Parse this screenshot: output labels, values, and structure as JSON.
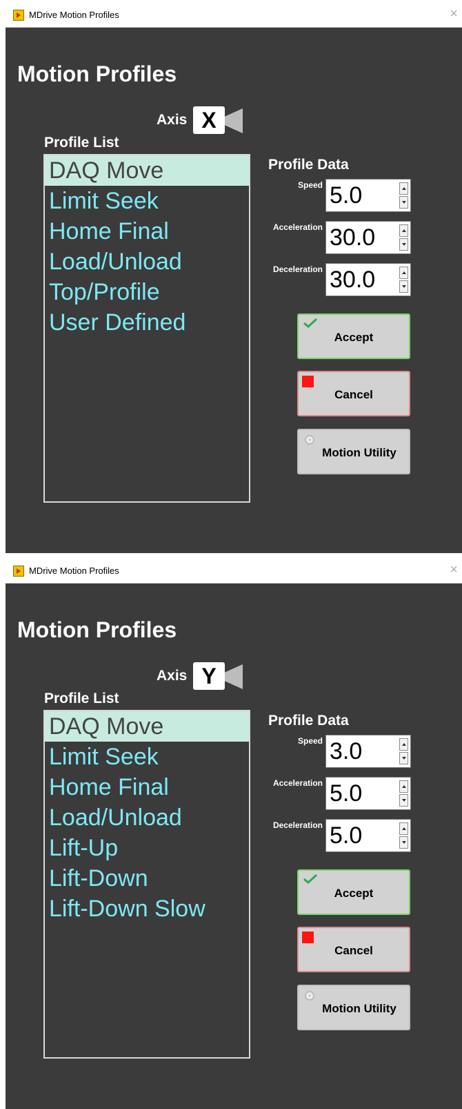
{
  "windows": [
    {
      "window_title": "MDrive Motion Profiles",
      "close": "×",
      "heading": "Motion Profiles",
      "axis_label": "Axis",
      "axis_value": "X",
      "profile_list_label": "Profile List",
      "profiles": [
        "DAQ Move",
        "Limit Seek",
        "Home Final",
        "Load/Unload",
        "Top/Profile",
        "User Defined",
        "",
        ""
      ],
      "selected_index": 0,
      "profile_data_label": "Profile Data",
      "fields": [
        {
          "label": "Speed",
          "value": "5.0"
        },
        {
          "label": "Acceleration",
          "value": "30.0"
        },
        {
          "label": "Deceleration",
          "value": "30.0"
        }
      ],
      "buttons": {
        "accept": "Accept",
        "cancel": "Cancel",
        "utility": "Motion Utility"
      }
    },
    {
      "window_title": "MDrive Motion Profiles",
      "close": "×",
      "heading": "Motion Profiles",
      "axis_label": "Axis",
      "axis_value": "Y",
      "profile_list_label": "Profile List",
      "profiles": [
        "DAQ Move",
        "Limit Seek",
        "Home Final",
        "Load/Unload",
        "Lift-Up",
        "Lift-Down",
        "Lift-Down Slow",
        ""
      ],
      "selected_index": 0,
      "profile_data_label": "Profile Data",
      "fields": [
        {
          "label": "Speed",
          "value": "3.0"
        },
        {
          "label": "Acceleration",
          "value": "5.0"
        },
        {
          "label": "Deceleration",
          "value": "5.0"
        }
      ],
      "buttons": {
        "accept": "Accept",
        "cancel": "Cancel",
        "utility": "Motion Utility"
      }
    }
  ],
  "colors": {
    "window_bg": "#3b3b3b",
    "list_text": "#7fe8f4",
    "selected_bg": "#c8ebe0",
    "accept_border": "#7ad36a",
    "cancel_border": "#e08a8a",
    "stop_icon": "#ff1414"
  },
  "icons": {
    "app": "app-icon",
    "close": "close-icon",
    "accept": "checkmark-icon",
    "cancel": "stop-icon",
    "utility": "gear-icon",
    "axis_pointer": "arrow-left-icon"
  }
}
